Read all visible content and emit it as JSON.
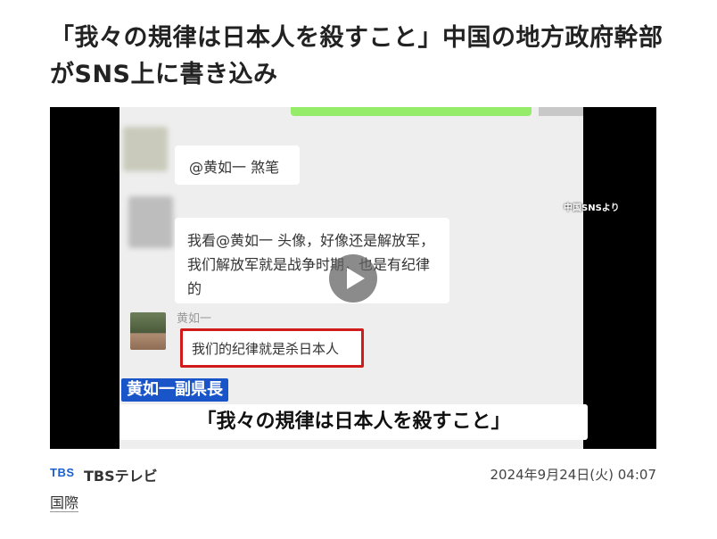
{
  "article": {
    "headline": "「我々の規律は日本人を殺すこと」中国の地方政府幹部がSNS上に書き込み"
  },
  "video": {
    "source_tag": "中国SNSより",
    "chat": {
      "message1": "@黄如一 煞笔",
      "message2": "我看@黄如一 头像，好像还是解放军，我们解放军就是战争时期，也是有纪律的",
      "sender_name": "黄如一",
      "message3": "我们的纪律就是杀日本人"
    },
    "name_label": "黄如一副県長",
    "caption": "「我々の規律は日本人を殺すこと」",
    "play_icon": "play-icon"
  },
  "meta": {
    "publisher_logo": "TBS",
    "publisher": "TBSテレビ",
    "timestamp": "2024年9月24日(火) 04:07",
    "category": "国際"
  },
  "colors": {
    "highlight_border": "#d11a1a",
    "name_label_bg": "#1955c9",
    "logo": "#1a5fd0"
  }
}
